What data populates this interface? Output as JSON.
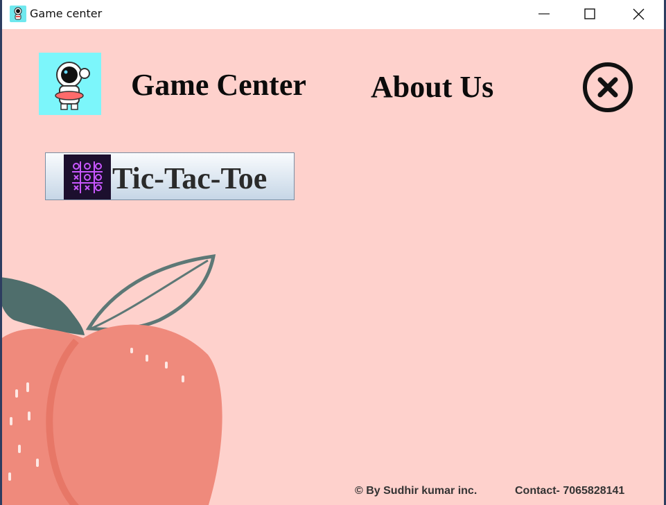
{
  "window": {
    "title": "Game center",
    "icon": "astronaut-icon"
  },
  "nav": {
    "logo_icon": "astronaut-logo",
    "game_center_label": "Game Center",
    "about_us_label": "About Us",
    "close_icon": "circle-x-icon"
  },
  "games": [
    {
      "label": "Tic-Tac-Toe",
      "icon": "tic-tac-toe-neon-icon"
    }
  ],
  "footer": {
    "copyright": "© By Sudhir kumar inc.",
    "contact": "Contact- 7065828141"
  },
  "colors": {
    "background": "#fed1cc",
    "peach": "#ef8a7c",
    "leaf": "#4f6e6c",
    "text": "#0b0b0b"
  }
}
